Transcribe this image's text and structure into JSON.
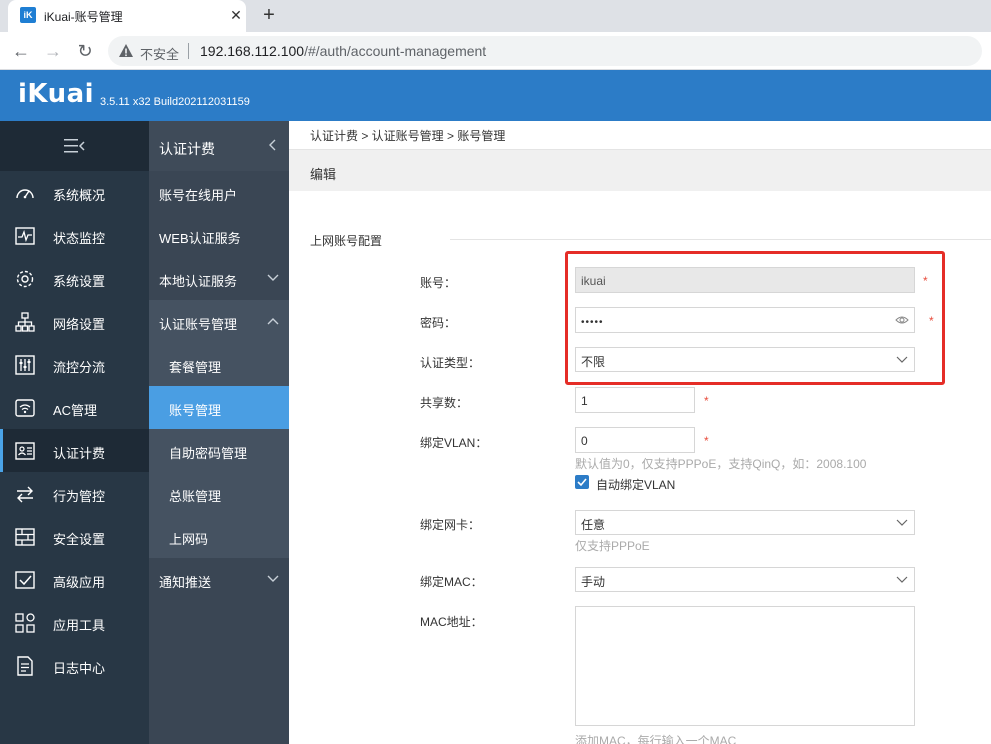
{
  "browser": {
    "tab_title": "iKuai-账号管理",
    "tab_favicon_text": "iK",
    "insecure_label": "不安全",
    "url_host": "192.168.112.100",
    "url_path": "/#/auth/account-management"
  },
  "header": {
    "logo": "iKuai",
    "version": "3.5.11 x32 Build202112031159"
  },
  "sidebar": {
    "items": [
      {
        "label": "系统概况",
        "icon": "dashboard-icon"
      },
      {
        "label": "状态监控",
        "icon": "monitor-icon"
      },
      {
        "label": "系统设置",
        "icon": "gear-icon"
      },
      {
        "label": "网络设置",
        "icon": "network-icon"
      },
      {
        "label": "流控分流",
        "icon": "sliders-icon"
      },
      {
        "label": "AC管理",
        "icon": "wifi-icon"
      },
      {
        "label": "认证计费",
        "icon": "id-card-icon"
      },
      {
        "label": "行为管控",
        "icon": "arrows-icon"
      },
      {
        "label": "安全设置",
        "icon": "firewall-icon"
      },
      {
        "label": "高级应用",
        "icon": "checkbox-icon"
      },
      {
        "label": "应用工具",
        "icon": "tools-icon"
      },
      {
        "label": "日志中心",
        "icon": "log-icon"
      }
    ],
    "active": "认证计费"
  },
  "subsidebar": {
    "title": "认证计费",
    "items": [
      {
        "label": "账号在线用户"
      },
      {
        "label": "WEB认证服务"
      },
      {
        "label": "本地认证服务"
      },
      {
        "label": "认证账号管理"
      },
      {
        "label": "套餐管理"
      },
      {
        "label": "账号管理"
      },
      {
        "label": "自助密码管理"
      },
      {
        "label": "总账管理"
      },
      {
        "label": "上网码"
      },
      {
        "label": "通知推送"
      }
    ]
  },
  "main": {
    "breadcrumb": "认证计费 > 认证账号管理 > 账号管理",
    "edit_title": "编辑",
    "section_title": "上网账号配置",
    "fields": {
      "account": {
        "label": "账号：",
        "value": "ikuai"
      },
      "password": {
        "label": "密码：",
        "value": "•••••"
      },
      "auth_type": {
        "label": "认证类型：",
        "value": "不限"
      },
      "share_count": {
        "label": "共享数：",
        "value": "1"
      },
      "vlan": {
        "label": "绑定VLAN：",
        "value": "0",
        "hint": "默认值为0，仅支持PPPoE，支持QinQ，如：2008.100"
      },
      "auto_vlan": {
        "label": "自动绑定VLAN",
        "checked": true
      },
      "nic": {
        "label": "绑定网卡：",
        "value": "任意",
        "hint": "仅支持PPPoE"
      },
      "mac_bind": {
        "label": "绑定MAC：",
        "value": "手动"
      },
      "mac_addr": {
        "label": "MAC地址：",
        "hint": "添加MAC，每行输入一个MAC"
      }
    },
    "required_mark": "*"
  },
  "colors": {
    "header": "#2c7cc7",
    "sidebar": "#283745",
    "subsidebar": "#3a4654",
    "selected": "#4a9ee3",
    "highlight": "#e52d27"
  }
}
